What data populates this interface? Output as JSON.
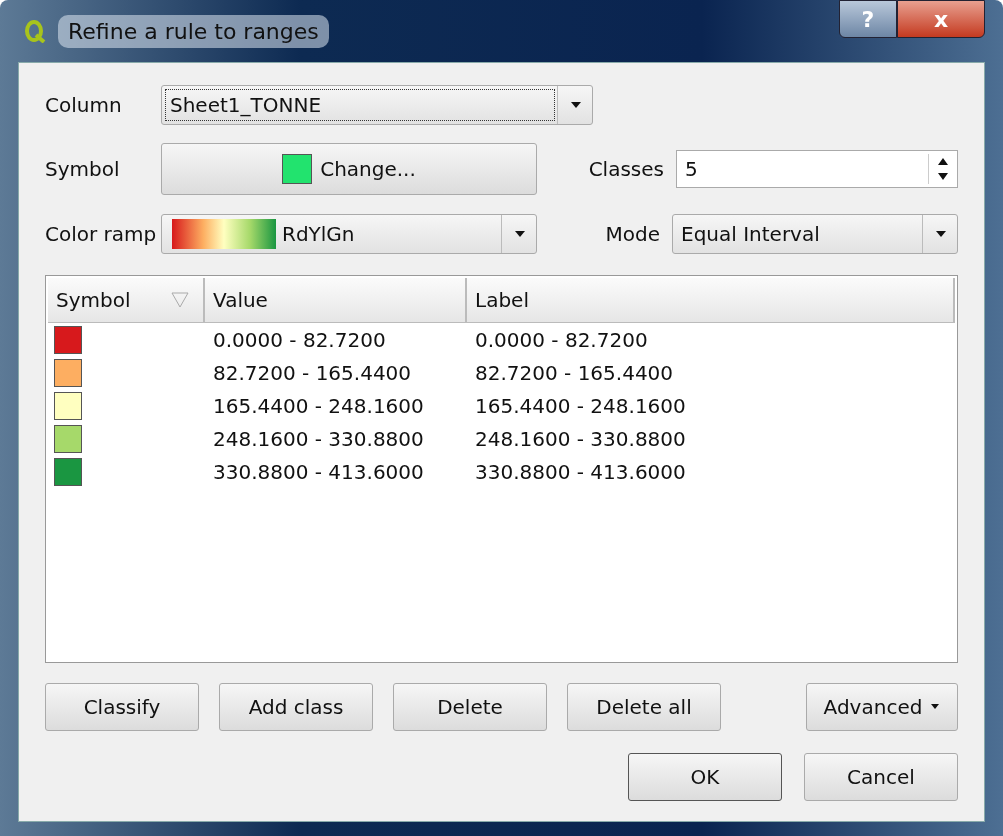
{
  "window": {
    "title": "Refine a rule to ranges",
    "help_button": "?",
    "close_button": "x"
  },
  "column": {
    "label": "Column",
    "value": "Sheet1_TONNE"
  },
  "symbol": {
    "label": "Symbol",
    "button": "Change...",
    "color": "#22e36e"
  },
  "classes": {
    "label": "Classes",
    "value": "5"
  },
  "color_ramp": {
    "label": "Color ramp",
    "value": "RdYlGn"
  },
  "mode": {
    "label": "Mode",
    "value": "Equal Interval"
  },
  "table": {
    "columns": [
      "Symbol",
      "Value",
      "Label"
    ],
    "rows": [
      {
        "color": "#d7191c",
        "value": "0.0000 - 82.7200",
        "label": "0.0000 - 82.7200"
      },
      {
        "color": "#fdae61",
        "value": "82.7200 - 165.4400",
        "label": "82.7200 - 165.4400"
      },
      {
        "color": "#ffffc0",
        "value": "165.4400 - 248.1600",
        "label": "165.4400 - 248.1600"
      },
      {
        "color": "#a6d96a",
        "value": "248.1600 - 330.8800",
        "label": "248.1600 - 330.8800"
      },
      {
        "color": "#1a9641",
        "value": "330.8800 - 413.6000",
        "label": "330.8800 - 413.6000"
      }
    ]
  },
  "actions": [
    "Classify",
    "Add class",
    "Delete",
    "Delete all"
  ],
  "advanced": "Advanced",
  "buttons": [
    "OK",
    "Cancel"
  ]
}
